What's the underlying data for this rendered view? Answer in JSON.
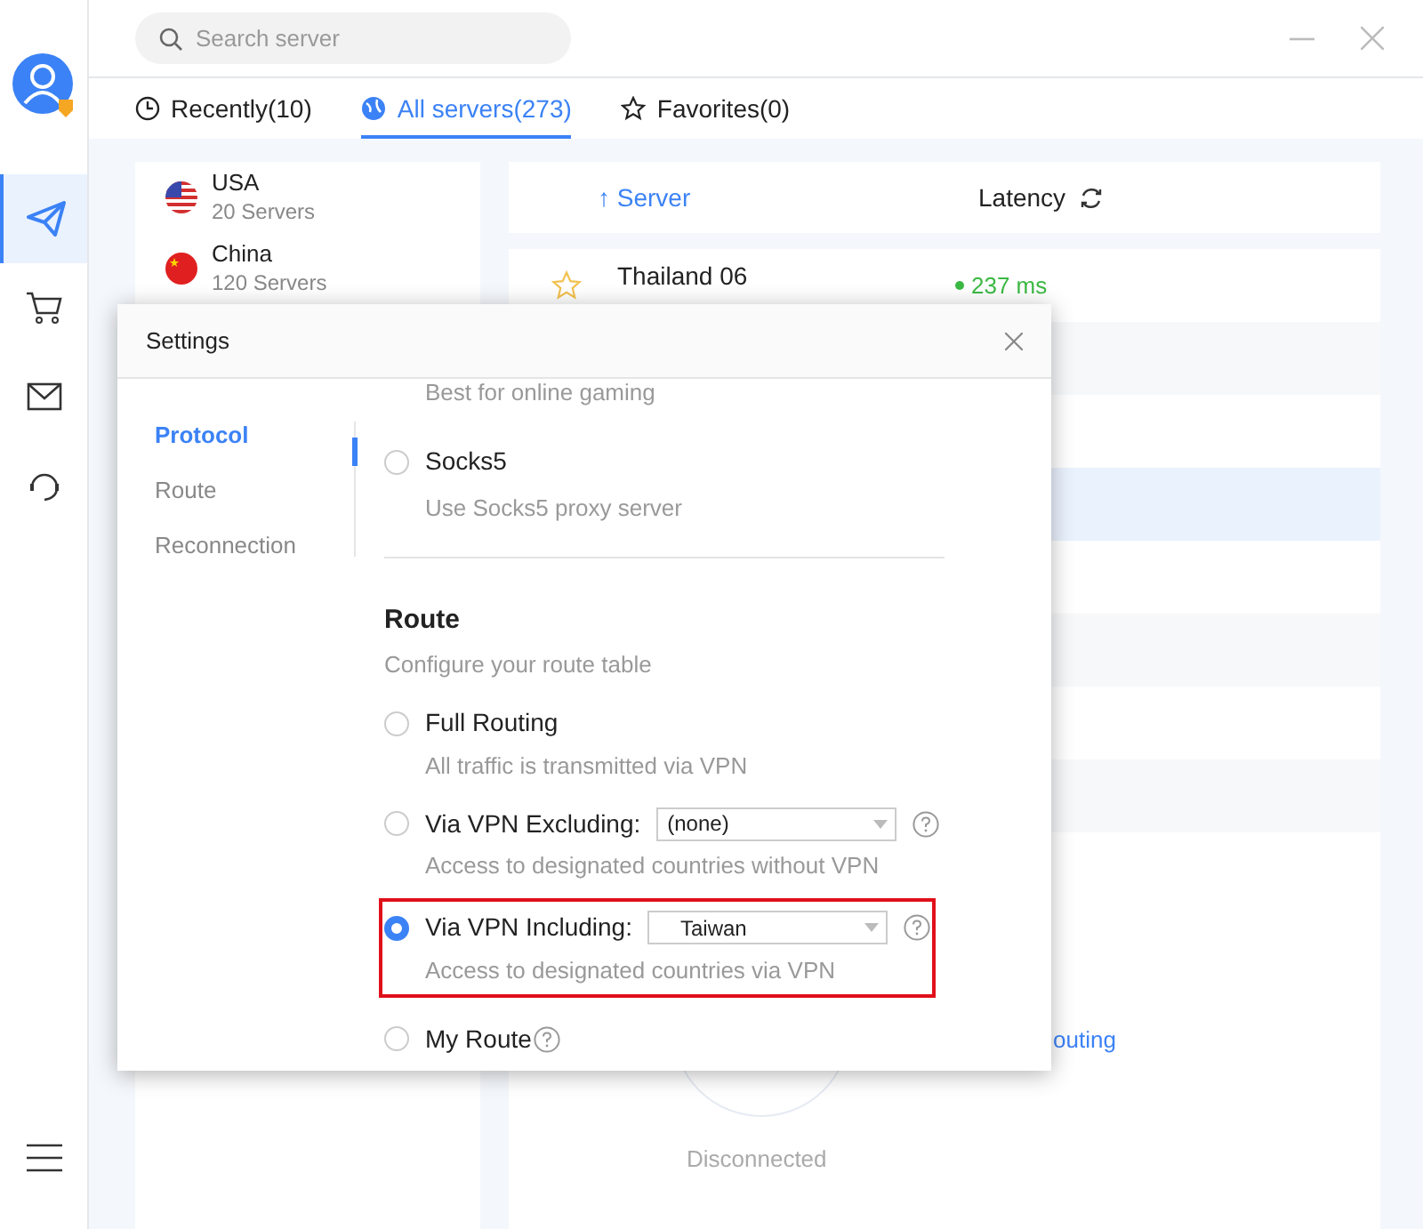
{
  "search": {
    "placeholder": "Search server"
  },
  "nav": [
    {
      "selected": true
    },
    {
      "selected": false
    },
    {
      "selected": false
    },
    {
      "selected": false
    }
  ],
  "tabs": [
    {
      "label": "Recently(10)",
      "selected": false
    },
    {
      "label": "All servers(273)",
      "selected": true
    },
    {
      "label": "Favorites(0)",
      "selected": false
    }
  ],
  "countries": [
    {
      "name": "USA",
      "count": "20 Servers"
    },
    {
      "name": "China",
      "count": "120 Servers"
    }
  ],
  "table": {
    "columns": [
      "↑ Server",
      "Latency"
    ],
    "rows": [
      {
        "name": "Thailand 06",
        "latency": "237 ms",
        "selected": false
      },
      {
        "name": "",
        "latency": "",
        "selected": false
      },
      {
        "name": "",
        "latency": "",
        "selected": false
      },
      {
        "name": "",
        "latency": "",
        "selected": true
      },
      {
        "name": "",
        "latency": "",
        "selected": false
      },
      {
        "name": "",
        "latency": "",
        "selected": false
      },
      {
        "name": "",
        "latency": "",
        "selected": false
      },
      {
        "name": "",
        "latency": "",
        "selected": false
      }
    ]
  },
  "connection": {
    "status": "Disconnected",
    "link": "outing"
  },
  "settings": {
    "title": "Settings",
    "nav": [
      {
        "label": "Protocol",
        "selected": true
      },
      {
        "label": "Route",
        "selected": false
      },
      {
        "label": "Reconnection",
        "selected": false
      }
    ],
    "top_note": "Best for online gaming",
    "protocol_options": [
      {
        "label": "Socks5",
        "description": "Use Socks5 proxy server",
        "selected": false
      }
    ],
    "route": {
      "heading": "Route",
      "description": "Configure your route table",
      "options": [
        {
          "kind": "plain",
          "label": "Full Routing",
          "description": "All traffic is transmitted via VPN",
          "selected": false,
          "highlighted": false
        },
        {
          "kind": "select",
          "label": "Via VPN Excluding:",
          "value": "(none)",
          "description": "Access to designated countries without VPN",
          "selected": false,
          "highlighted": false
        },
        {
          "kind": "select",
          "label": "Via VPN Including:",
          "value": "Taiwan",
          "description": "Access to designated countries via VPN",
          "selected": true,
          "highlighted": true
        },
        {
          "kind": "help",
          "label": "My Route",
          "selected": false,
          "highlighted": false
        }
      ]
    }
  }
}
